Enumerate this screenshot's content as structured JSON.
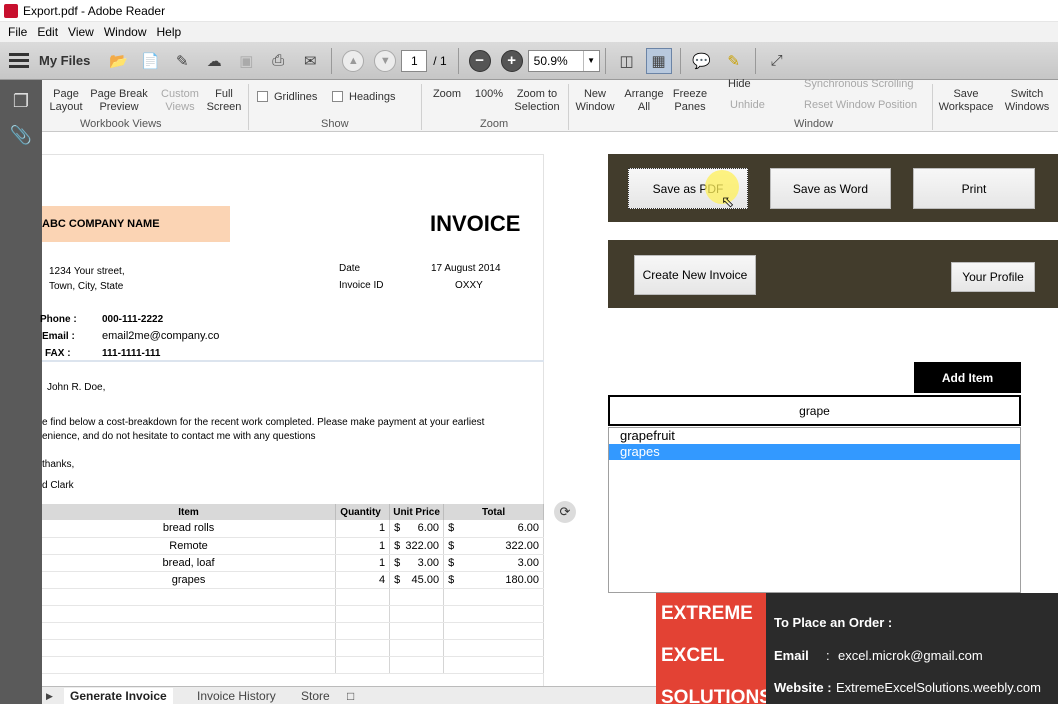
{
  "window": {
    "title": "Export.pdf - Adobe Reader"
  },
  "menu": [
    "File",
    "Edit",
    "View",
    "Window",
    "Help"
  ],
  "toolbar": {
    "my_files": "My Files",
    "page_current": "1",
    "page_total": "/ 1",
    "zoom": "50.9%"
  },
  "ribbon": {
    "page_layout": "Page\nLayout",
    "page_break": "Page Break\nPreview",
    "custom_views": "Custom\nViews",
    "full_screen": "Full\nScreen",
    "group_workbook_views": "Workbook Views",
    "gridlines": "Gridlines",
    "headings": "Headings",
    "group_show": "Show",
    "zoom": "Zoom",
    "zoom_100": "100%",
    "zoom_selection": "Zoom to\nSelection",
    "group_zoom": "Zoom",
    "new_window": "New\nWindow",
    "arrange_all": "Arrange\nAll",
    "freeze_panes": "Freeze\nPanes",
    "hide": "Hide",
    "unhide": "Unhide",
    "sync_scrolling": "Synchronous Scrolling",
    "reset_window": "Reset Window Position",
    "group_window": "Window",
    "save_workspace": "Save\nWorkspace",
    "switch_windows": "Switch\nWindows"
  },
  "invoice": {
    "company_name": "ABC COMPANY NAME",
    "title": "INVOICE",
    "address_line1": "1234 Your street,",
    "address_line2": "Town, City, State",
    "date_label": "Date",
    "date_value": "17 August 2014",
    "invoice_id_label": "Invoice ID",
    "invoice_id_value": "OXXY",
    "phone_label": "Phone :",
    "phone_value": "000-111-2222",
    "email_label": "Email :",
    "email_value": "email2me@company.co",
    "fax_label": "FAX :",
    "fax_value": "111-1111-111",
    "recipient": "John R. Doe,",
    "message_line1": "e find below a cost-breakdown for the recent work completed. Please make payment at your earliest",
    "message_line2": "enience, and do not hesitate to contact me with any questions",
    "thanks": "thanks,",
    "signature": "d Clark",
    "headers": {
      "item": "Item",
      "quantity": "Quantity",
      "unit_price": "Unit Price",
      "total": "Total"
    },
    "rows": [
      {
        "item": "bread rolls",
        "qty": "1",
        "unit_sym": "$",
        "unit": "6.00",
        "tot_sym": "$",
        "total": "6.00"
      },
      {
        "item": "Remote",
        "qty": "1",
        "unit_sym": "$",
        "unit": "322.00",
        "tot_sym": "$",
        "total": "322.00"
      },
      {
        "item": "bread, loaf",
        "qty": "1",
        "unit_sym": "$",
        "unit": "3.00",
        "tot_sym": "$",
        "total": "3.00"
      },
      {
        "item": "grapes",
        "qty": "4",
        "unit_sym": "$",
        "unit": "45.00",
        "tot_sym": "$",
        "total": "180.00"
      }
    ]
  },
  "panel": {
    "save_pdf": "Save as PDF",
    "save_word": "Save as Word",
    "print": "Print",
    "create_invoice": "Create New Invoice",
    "your_profile": "Your Profile",
    "add_item": "Add Item",
    "search_value": "grape",
    "options": [
      "grapefruit",
      "grapes"
    ],
    "selected_option": "grapes"
  },
  "sheet_tabs": [
    "Generate Invoice",
    "Invoice History",
    "Store"
  ],
  "ad": {
    "logo_line1": "EXTREME",
    "logo_line2": "EXCEL",
    "logo_line3": "SOLUTIONS",
    "order_label": "To Place an Order :",
    "email_label": "Email",
    "email_sep": ":",
    "email_value": "excel.microk@gmail.com",
    "website_label": "Website :",
    "website_value": "ExtremeExcelSolutions.weebly.com"
  },
  "colors": {
    "accent_panel": "#423c2c",
    "company_fill": "#fbd4b4",
    "list_selection": "#3399ff",
    "ad_red": "#e34234"
  }
}
